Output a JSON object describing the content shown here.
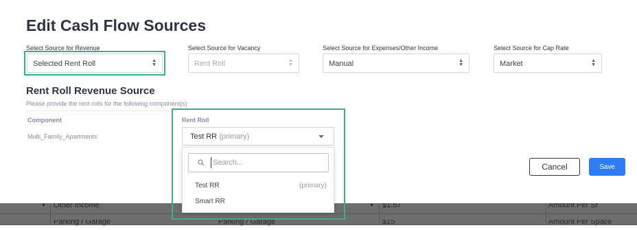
{
  "modal": {
    "title": "Edit Cash Flow Sources",
    "sources": [
      {
        "label": "Select Source for Revenue",
        "value": "Selected Rent Roll",
        "disabled": false
      },
      {
        "label": "Select Source for Vacancy",
        "value": "Rent Roll",
        "disabled": true
      },
      {
        "label": "Select Source for Expenses/Other Income",
        "value": "Manual",
        "disabled": false
      },
      {
        "label": "Select Source for Cap Rate",
        "value": "Market",
        "disabled": false
      }
    ],
    "rent_roll_section": {
      "title": "Rent Roll Revenue Source",
      "hint": "Please provide the rent rolls for the following component(s):",
      "col_component": "Component",
      "col_rent_roll": "Rent Roll",
      "component_name": "Multi_Family_Apartments",
      "selected_value": "Test RR",
      "selected_tag": "(primary)",
      "search_placeholder": "Search...",
      "options": [
        {
          "label": "Test RR",
          "tag": "(primary)"
        },
        {
          "label": "Smart RR",
          "tag": ""
        }
      ]
    },
    "buttons": {
      "cancel": "Cancel",
      "save": "Save"
    }
  },
  "background_table": {
    "row1": {
      "c1": "Other Income",
      "c3": "$1.57",
      "c4": "Amount Per Sf"
    },
    "row2": {
      "c1": "Parking / Garage",
      "c2": "Parking / Garage",
      "c3": "$15",
      "c4": "Amount Per Space"
    }
  },
  "colors": {
    "highlight": "#3eae8a",
    "primary": "#2f7df6",
    "title": "#2f3444"
  }
}
